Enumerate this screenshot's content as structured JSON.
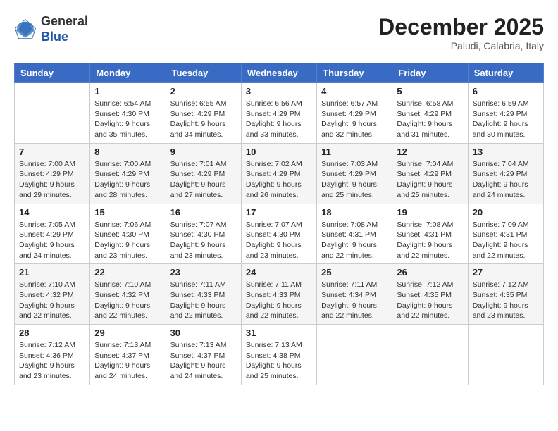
{
  "header": {
    "logo_general": "General",
    "logo_blue": "Blue",
    "month_year": "December 2025",
    "location": "Paludi, Calabria, Italy"
  },
  "weekdays": [
    "Sunday",
    "Monday",
    "Tuesday",
    "Wednesday",
    "Thursday",
    "Friday",
    "Saturday"
  ],
  "weeks": [
    [
      {
        "day": "",
        "sunrise": "",
        "sunset": "",
        "daylight": ""
      },
      {
        "day": "1",
        "sunrise": "Sunrise: 6:54 AM",
        "sunset": "Sunset: 4:30 PM",
        "daylight": "Daylight: 9 hours and 35 minutes."
      },
      {
        "day": "2",
        "sunrise": "Sunrise: 6:55 AM",
        "sunset": "Sunset: 4:29 PM",
        "daylight": "Daylight: 9 hours and 34 minutes."
      },
      {
        "day": "3",
        "sunrise": "Sunrise: 6:56 AM",
        "sunset": "Sunset: 4:29 PM",
        "daylight": "Daylight: 9 hours and 33 minutes."
      },
      {
        "day": "4",
        "sunrise": "Sunrise: 6:57 AM",
        "sunset": "Sunset: 4:29 PM",
        "daylight": "Daylight: 9 hours and 32 minutes."
      },
      {
        "day": "5",
        "sunrise": "Sunrise: 6:58 AM",
        "sunset": "Sunset: 4:29 PM",
        "daylight": "Daylight: 9 hours and 31 minutes."
      },
      {
        "day": "6",
        "sunrise": "Sunrise: 6:59 AM",
        "sunset": "Sunset: 4:29 PM",
        "daylight": "Daylight: 9 hours and 30 minutes."
      }
    ],
    [
      {
        "day": "7",
        "sunrise": "Sunrise: 7:00 AM",
        "sunset": "Sunset: 4:29 PM",
        "daylight": "Daylight: 9 hours and 29 minutes."
      },
      {
        "day": "8",
        "sunrise": "Sunrise: 7:00 AM",
        "sunset": "Sunset: 4:29 PM",
        "daylight": "Daylight: 9 hours and 28 minutes."
      },
      {
        "day": "9",
        "sunrise": "Sunrise: 7:01 AM",
        "sunset": "Sunset: 4:29 PM",
        "daylight": "Daylight: 9 hours and 27 minutes."
      },
      {
        "day": "10",
        "sunrise": "Sunrise: 7:02 AM",
        "sunset": "Sunset: 4:29 PM",
        "daylight": "Daylight: 9 hours and 26 minutes."
      },
      {
        "day": "11",
        "sunrise": "Sunrise: 7:03 AM",
        "sunset": "Sunset: 4:29 PM",
        "daylight": "Daylight: 9 hours and 25 minutes."
      },
      {
        "day": "12",
        "sunrise": "Sunrise: 7:04 AM",
        "sunset": "Sunset: 4:29 PM",
        "daylight": "Daylight: 9 hours and 25 minutes."
      },
      {
        "day": "13",
        "sunrise": "Sunrise: 7:04 AM",
        "sunset": "Sunset: 4:29 PM",
        "daylight": "Daylight: 9 hours and 24 minutes."
      }
    ],
    [
      {
        "day": "14",
        "sunrise": "Sunrise: 7:05 AM",
        "sunset": "Sunset: 4:29 PM",
        "daylight": "Daylight: 9 hours and 24 minutes."
      },
      {
        "day": "15",
        "sunrise": "Sunrise: 7:06 AM",
        "sunset": "Sunset: 4:30 PM",
        "daylight": "Daylight: 9 hours and 23 minutes."
      },
      {
        "day": "16",
        "sunrise": "Sunrise: 7:07 AM",
        "sunset": "Sunset: 4:30 PM",
        "daylight": "Daylight: 9 hours and 23 minutes."
      },
      {
        "day": "17",
        "sunrise": "Sunrise: 7:07 AM",
        "sunset": "Sunset: 4:30 PM",
        "daylight": "Daylight: 9 hours and 23 minutes."
      },
      {
        "day": "18",
        "sunrise": "Sunrise: 7:08 AM",
        "sunset": "Sunset: 4:31 PM",
        "daylight": "Daylight: 9 hours and 22 minutes."
      },
      {
        "day": "19",
        "sunrise": "Sunrise: 7:08 AM",
        "sunset": "Sunset: 4:31 PM",
        "daylight": "Daylight: 9 hours and 22 minutes."
      },
      {
        "day": "20",
        "sunrise": "Sunrise: 7:09 AM",
        "sunset": "Sunset: 4:31 PM",
        "daylight": "Daylight: 9 hours and 22 minutes."
      }
    ],
    [
      {
        "day": "21",
        "sunrise": "Sunrise: 7:10 AM",
        "sunset": "Sunset: 4:32 PM",
        "daylight": "Daylight: 9 hours and 22 minutes."
      },
      {
        "day": "22",
        "sunrise": "Sunrise: 7:10 AM",
        "sunset": "Sunset: 4:32 PM",
        "daylight": "Daylight: 9 hours and 22 minutes."
      },
      {
        "day": "23",
        "sunrise": "Sunrise: 7:11 AM",
        "sunset": "Sunset: 4:33 PM",
        "daylight": "Daylight: 9 hours and 22 minutes."
      },
      {
        "day": "24",
        "sunrise": "Sunrise: 7:11 AM",
        "sunset": "Sunset: 4:33 PM",
        "daylight": "Daylight: 9 hours and 22 minutes."
      },
      {
        "day": "25",
        "sunrise": "Sunrise: 7:11 AM",
        "sunset": "Sunset: 4:34 PM",
        "daylight": "Daylight: 9 hours and 22 minutes."
      },
      {
        "day": "26",
        "sunrise": "Sunrise: 7:12 AM",
        "sunset": "Sunset: 4:35 PM",
        "daylight": "Daylight: 9 hours and 22 minutes."
      },
      {
        "day": "27",
        "sunrise": "Sunrise: 7:12 AM",
        "sunset": "Sunset: 4:35 PM",
        "daylight": "Daylight: 9 hours and 23 minutes."
      }
    ],
    [
      {
        "day": "28",
        "sunrise": "Sunrise: 7:12 AM",
        "sunset": "Sunset: 4:36 PM",
        "daylight": "Daylight: 9 hours and 23 minutes."
      },
      {
        "day": "29",
        "sunrise": "Sunrise: 7:13 AM",
        "sunset": "Sunset: 4:37 PM",
        "daylight": "Daylight: 9 hours and 24 minutes."
      },
      {
        "day": "30",
        "sunrise": "Sunrise: 7:13 AM",
        "sunset": "Sunset: 4:37 PM",
        "daylight": "Daylight: 9 hours and 24 minutes."
      },
      {
        "day": "31",
        "sunrise": "Sunrise: 7:13 AM",
        "sunset": "Sunset: 4:38 PM",
        "daylight": "Daylight: 9 hours and 25 minutes."
      },
      {
        "day": "",
        "sunrise": "",
        "sunset": "",
        "daylight": ""
      },
      {
        "day": "",
        "sunrise": "",
        "sunset": "",
        "daylight": ""
      },
      {
        "day": "",
        "sunrise": "",
        "sunset": "",
        "daylight": ""
      }
    ]
  ]
}
